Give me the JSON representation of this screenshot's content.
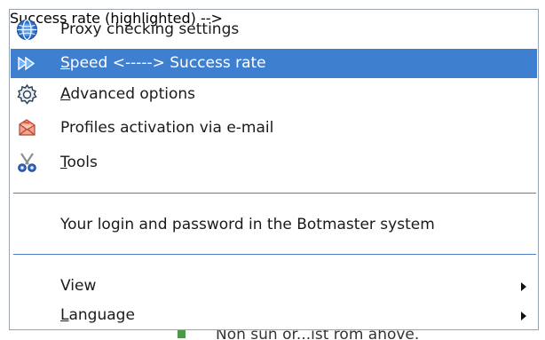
{
  "menu": {
    "items": [
      {
        "label": "Proxy checking settings",
        "icon": "globe-icon"
      },
      {
        "label_pre": "",
        "label_u": "S",
        "label_post": "peed <-----> Success rate",
        "icon": "fast-forward-icon"
      },
      {
        "label_pre": "",
        "label_u": "A",
        "label_post": "dvanced options",
        "icon": "gear-icon"
      },
      {
        "label": "Profiles activation via e-mail",
        "icon": "envelope-icon"
      },
      {
        "label_pre": "",
        "label_u": "T",
        "label_post": "ools",
        "icon": "scissors-icon"
      }
    ],
    "login_item": {
      "label": "Your login and password in the Botmaster system"
    },
    "view_item": {
      "label": "View"
    },
    "language_item": {
      "label_u": "L",
      "label_post": "anguage"
    }
  },
  "background": {
    "partial_text": "Non sun or...ist rom ahove."
  },
  "colors": {
    "highlight": "#3f7fd0",
    "separator": "#4a7fc8"
  }
}
